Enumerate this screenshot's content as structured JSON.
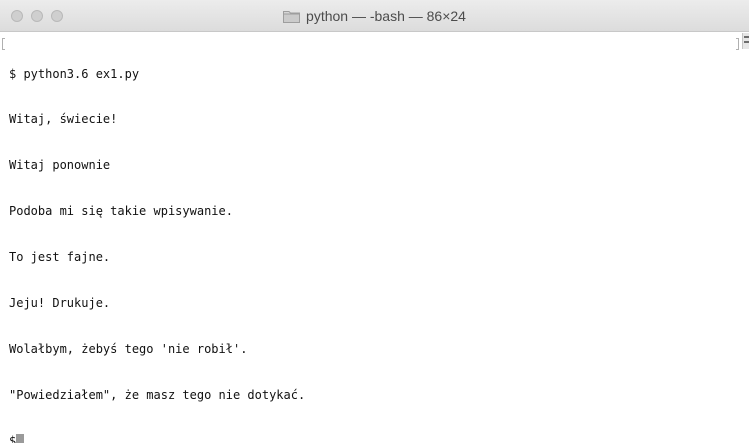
{
  "window": {
    "title": "python — -bash — 86×24",
    "title_icon": "folder-icon",
    "traffic_lights": [
      "close",
      "minimize",
      "zoom"
    ]
  },
  "terminal": {
    "lines": [
      "$ python3.6 ex1.py",
      "Witaj, świecie!",
      "Witaj ponownie",
      "Podoba mi się takie wpisywanie.",
      "To jest fajne.",
      "Jeju! Drukuje.",
      "Wolałbym, żebyś tego 'nie robił'.",
      "\"Powiedziałem\", że masz tego nie dotykać."
    ],
    "prompt": "$"
  },
  "colors": {
    "background": "#ffffff",
    "text": "#111111",
    "titlebar": "#dcdcdc",
    "cursor": "#9a9a9a"
  }
}
